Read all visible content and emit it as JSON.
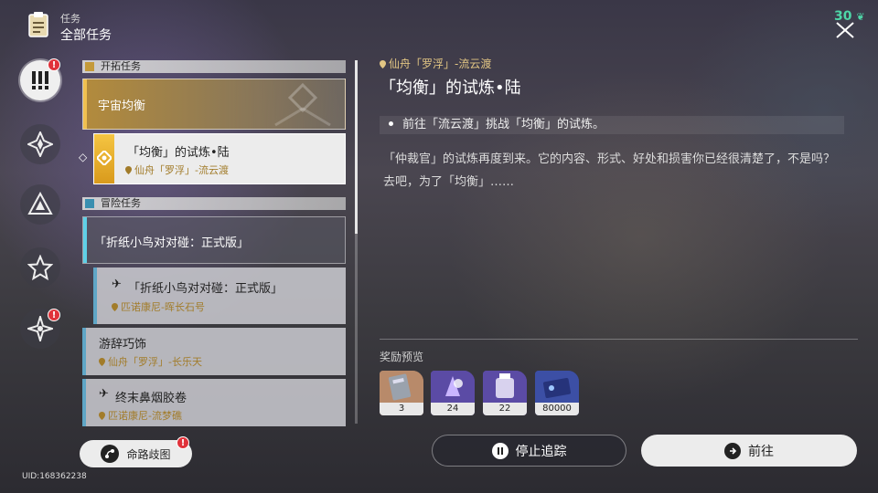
{
  "header": {
    "small_label": "任务",
    "title": "全部任务"
  },
  "top_right": {
    "power_value": "30"
  },
  "categories": [
    {
      "name": "all",
      "alert": "!"
    },
    {
      "name": "trailblaze",
      "alert": ""
    },
    {
      "name": "companion",
      "alert": ""
    },
    {
      "name": "adventure",
      "alert": ""
    },
    {
      "name": "daily",
      "alert": "!"
    }
  ],
  "sections": {
    "trailblaze": {
      "label": "开拓任务"
    },
    "adventure": {
      "label": "冒险任务"
    }
  },
  "quests": {
    "q1": {
      "title": "宇宙均衡"
    },
    "q2": {
      "title": "「均衡」的试炼•陆",
      "location": "仙舟「罗浮」-流云渡"
    },
    "q3": {
      "title": "「折纸小鸟对对碰：正式版」"
    },
    "q4": {
      "title": "「折纸小鸟对对碰：正式版」",
      "location": "匹诺康尼-晖长石号"
    },
    "q5": {
      "title": "游辞巧饰",
      "location": "仙舟「罗浮」-长乐天"
    },
    "q6": {
      "title": "终末鼻烟胶卷",
      "location": "匹诺康尼-流梦礁"
    }
  },
  "detail": {
    "location": "仙舟「罗浮」-流云渡",
    "title": "「均衡」的试炼•陆",
    "objective": "前往「流云渡」挑战「均衡」的试炼。",
    "description": "「仲裁官」的试炼再度到来。它的内容、形式、好处和损害你已经很清楚了，不是吗？去吧，为了「均衡」……"
  },
  "rewards": {
    "label": "奖励预览",
    "items": [
      {
        "qty": "3"
      },
      {
        "qty": "24"
      },
      {
        "qty": "22"
      },
      {
        "qty": "80000"
      }
    ]
  },
  "buttons": {
    "stop": "停止追踪",
    "go": "前往",
    "fate": "命路歧图",
    "fate_alert": "!"
  },
  "footer": {
    "uid": "UID:168362238"
  },
  "colors": {
    "accent_gold": "#e1c583",
    "power_green": "#4ed6a7",
    "alert_red": "#e0323a",
    "adventure_blue": "#5fd0e6"
  }
}
